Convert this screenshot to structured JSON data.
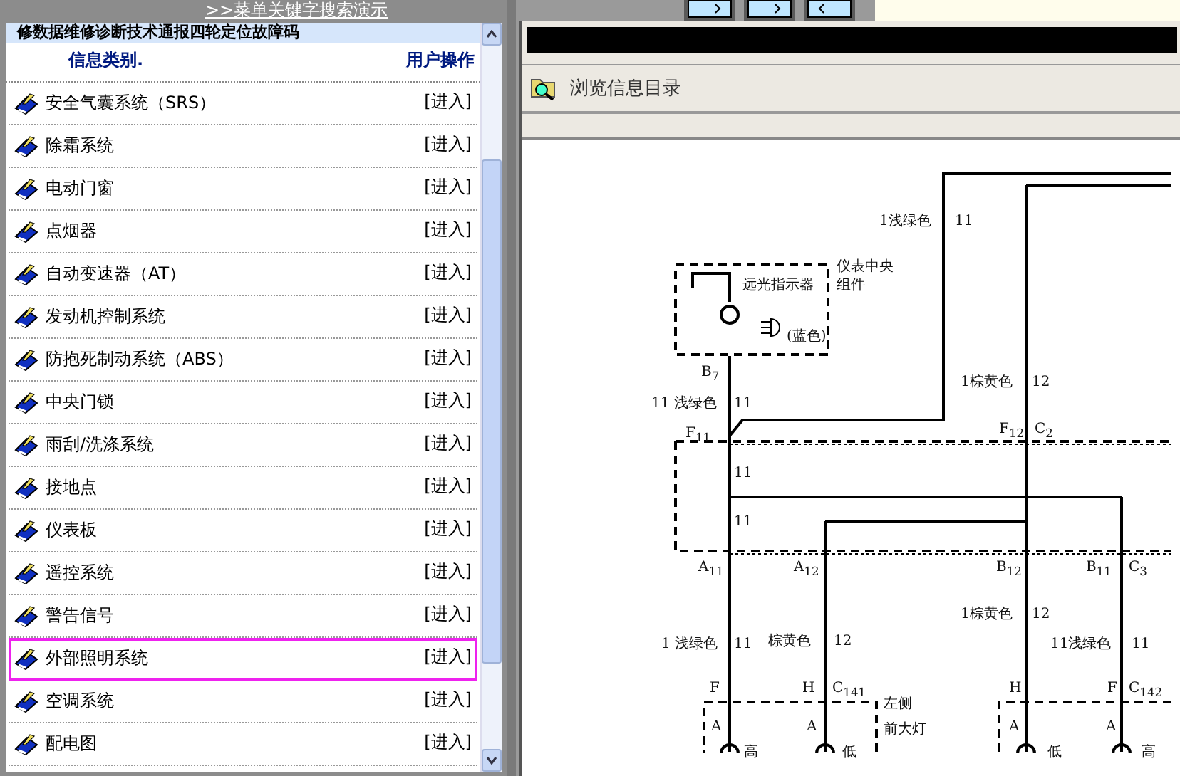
{
  "top_link": ">>菜单关键字搜索演示",
  "panel": {
    "title": "修数据维修诊断技术通报四轮定位故障码",
    "columns": [
      "信息类别.",
      "用户操作"
    ],
    "items": [
      {
        "label": "安全气囊系统（SRS）",
        "action": "[进入]",
        "selected": false
      },
      {
        "label": "除霜系统",
        "action": "[进入]",
        "selected": false
      },
      {
        "label": "电动门窗",
        "action": "[进入]",
        "selected": false
      },
      {
        "label": "点烟器",
        "action": "[进入]",
        "selected": false
      },
      {
        "label": "自动变速器（AT）",
        "action": "[进入]",
        "selected": false
      },
      {
        "label": "发动机控制系统",
        "action": "[进入]",
        "selected": false
      },
      {
        "label": "防抱死制动系统（ABS）",
        "action": "[进入]",
        "selected": false
      },
      {
        "label": "中央门锁",
        "action": "[进入]",
        "selected": false
      },
      {
        "label": "雨刮/洗涤系统",
        "action": "[进入]",
        "selected": false
      },
      {
        "label": "接地点",
        "action": "[进入]",
        "selected": false
      },
      {
        "label": "仪表板",
        "action": "[进入]",
        "selected": false
      },
      {
        "label": "遥控系统",
        "action": "[进入]",
        "selected": false
      },
      {
        "label": "警告信号",
        "action": "[进入]",
        "selected": false
      },
      {
        "label": "外部照明系统",
        "action": "[进入]",
        "selected": true
      },
      {
        "label": "空调系统",
        "action": "[进入]",
        "selected": false
      },
      {
        "label": "配电图",
        "action": "[进入]",
        "selected": false
      }
    ]
  },
  "viewer": {
    "toolbar_label": "浏览信息目录",
    "diagram_labels": [
      "1浅绿色",
      "11",
      "仪表中央",
      "组件",
      "远光指示器",
      "(蓝色)",
      "B$_{7}$",
      "11 浅绿色",
      "11",
      "F$_{11}$",
      "1棕黄色",
      "12",
      "F$_{12}$",
      "C$_{2}$",
      "11",
      "11",
      "A$_{11}$",
      "A$_{12}$",
      "B$_{12}$",
      "B$_{11}$",
      "C$_{3}$",
      "1 浅绿色",
      "11",
      "棕黄色",
      "12",
      "1棕黄色",
      "12",
      "11浅绿色",
      "11",
      "F",
      "H",
      "C$_{141}$",
      "左侧",
      "前大灯",
      "H",
      "F",
      "C$_{142}$",
      "A",
      "A",
      "A",
      "A",
      "高",
      "低",
      "低",
      "高"
    ]
  }
}
